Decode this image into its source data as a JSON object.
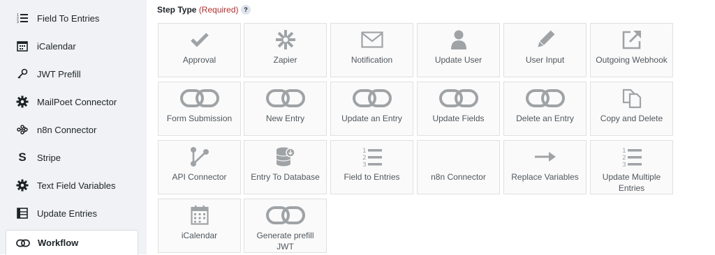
{
  "sidebar": {
    "items": [
      {
        "label": "Field To Entries",
        "icon": "numbered-list-icon"
      },
      {
        "label": "iCalendar",
        "icon": "calendar-icon"
      },
      {
        "label": "JWT Prefill",
        "icon": "key-icon"
      },
      {
        "label": "MailPoet Connector",
        "icon": "gear-icon"
      },
      {
        "label": "n8n Connector",
        "icon": "n8n-icon"
      },
      {
        "label": "Stripe",
        "icon": "stripe-icon"
      },
      {
        "label": "Text Field Variables",
        "icon": "gear-icon"
      },
      {
        "label": "Update Entries",
        "icon": "table-icon"
      },
      {
        "label": "Workflow",
        "icon": "link-icon",
        "active": true
      }
    ]
  },
  "main": {
    "heading": "Step Type",
    "required": "(Required)",
    "help": "?",
    "step_types": [
      {
        "label": "Approval",
        "icon": "checkmark-icon"
      },
      {
        "label": "Zapier",
        "icon": "zapier-icon"
      },
      {
        "label": "Notification",
        "icon": "envelope-icon"
      },
      {
        "label": "Update User",
        "icon": "user-icon"
      },
      {
        "label": "User Input",
        "icon": "pencil-icon"
      },
      {
        "label": "Outgoing Webhook",
        "icon": "external-link-icon"
      },
      {
        "label": "Form Submission",
        "icon": "link-icon"
      },
      {
        "label": "New Entry",
        "icon": "link-icon"
      },
      {
        "label": "Update an Entry",
        "icon": "link-icon"
      },
      {
        "label": "Update Fields",
        "icon": "link-icon"
      },
      {
        "label": "Delete an Entry",
        "icon": "link-icon"
      },
      {
        "label": "Copy and Delete",
        "icon": "copy-icon"
      },
      {
        "label": "API Connector",
        "icon": "share-icon"
      },
      {
        "label": "Entry To Database",
        "icon": "database-icon"
      },
      {
        "label": "Field to Entries",
        "icon": "numbered-list-icon"
      },
      {
        "label": "n8n Connector",
        "icon": "none"
      },
      {
        "label": "Replace Variables",
        "icon": "arrow-right-icon"
      },
      {
        "label": "Update Multiple Entries",
        "icon": "numbered-list-icon"
      },
      {
        "label": "iCalendar",
        "icon": "calendar-icon"
      },
      {
        "label": "Generate prefill JWT",
        "icon": "link-icon"
      }
    ]
  }
}
